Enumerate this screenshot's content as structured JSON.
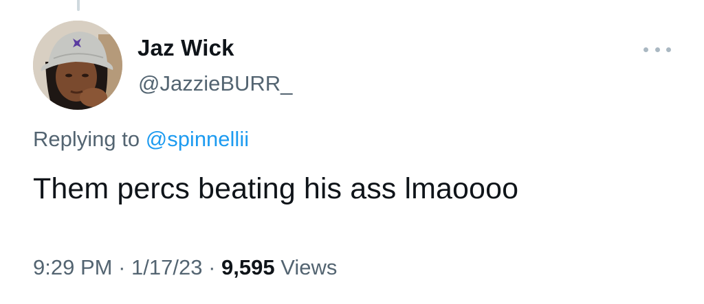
{
  "tweet": {
    "author": {
      "display_name": "Jaz Wick",
      "handle": "@JazzieBURR_"
    },
    "reply_prefix": "Replying to",
    "reply_to": "@spinnellii",
    "text": "Them percs beating his ass lmaoooo",
    "time": "9:29 PM",
    "separator": "·",
    "date": "1/17/23",
    "views_count": "9,595",
    "views_label": "Views",
    "more_icon": "more-horizontal-icon"
  },
  "colors": {
    "text_primary": "#0f1419",
    "text_secondary": "#536471",
    "link": "#1d9bf0",
    "thread_line": "#cfd9de"
  }
}
